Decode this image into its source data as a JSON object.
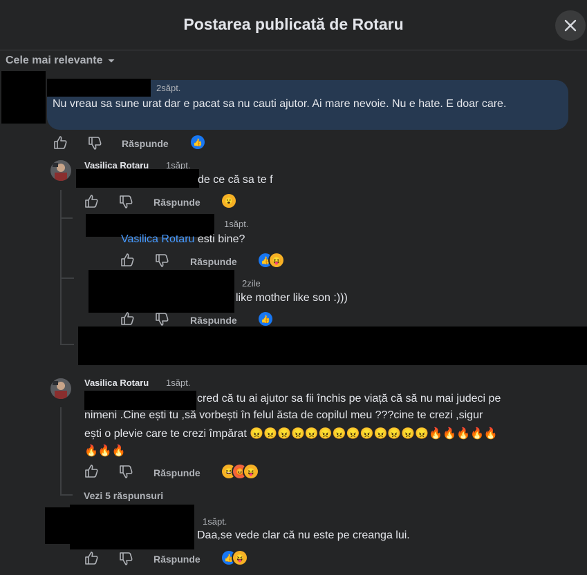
{
  "header": {
    "title": "Postarea publicată de Rotaru"
  },
  "sort": {
    "label": "Cele mai relevante"
  },
  "comments": [
    {
      "time": "2săpt.",
      "text": "Nu vreau sa sune urat dar e pacat sa nu cauti ajutor. Ai mare nevoie. Nu e hate. E doar care.",
      "reply_label": "Răspunde",
      "reactions": [
        "like"
      ]
    },
    {
      "author": "Vasilica Rotaru",
      "time": "1săpt.",
      "text": "de ce că sa te f",
      "reply_label": "Răspunde",
      "reactions": [
        "wow"
      ]
    },
    {
      "time": "1săpt.",
      "mention": "Vasilica Rotaru",
      "text": "esti bine?",
      "reply_label": "Răspunde",
      "reactions": [
        "like",
        "tongue"
      ]
    },
    {
      "time": "2zile",
      "text": "like mother like son :)))",
      "reply_label": "Răspunde",
      "reactions": [
        "like"
      ]
    },
    {
      "author": "Vasilica Rotaru",
      "time": "1săpt.",
      "text_line1": "cred că tu ai ajutor sa fii închis pe viață că să nu mai judeci pe",
      "text_line2": "nimeni .Cine ești tu ,să vorbești în felul ăsta de copilul meu ???cine te crezi ,sigur",
      "text_line3": "ești o plevie care te crezi împărat 😠😠😠😠😠😠😠😠😠😠😠😠😠🔥🔥🔥🔥🔥",
      "text_line4": "🔥🔥🔥",
      "reply_label": "Răspunde",
      "reactions": [
        "haha",
        "angry",
        "tongue"
      ],
      "view_replies": "Vezi 5 răspunsuri"
    },
    {
      "time": "1săpt.",
      "text": "Daa,se vede clar că nu este pe creanga lui.",
      "reply_label": "Răspunde",
      "reactions": [
        "like",
        "tongue"
      ]
    }
  ],
  "icons": {
    "close": "close-icon",
    "sort": "caret-down-icon",
    "like": "thumbs-up-icon",
    "dislike": "thumbs-down-icon"
  },
  "colors": {
    "background": "#242526",
    "bubble_highlight": "#263951",
    "like_blue": "#1877f2",
    "mention": "#4599ff"
  }
}
